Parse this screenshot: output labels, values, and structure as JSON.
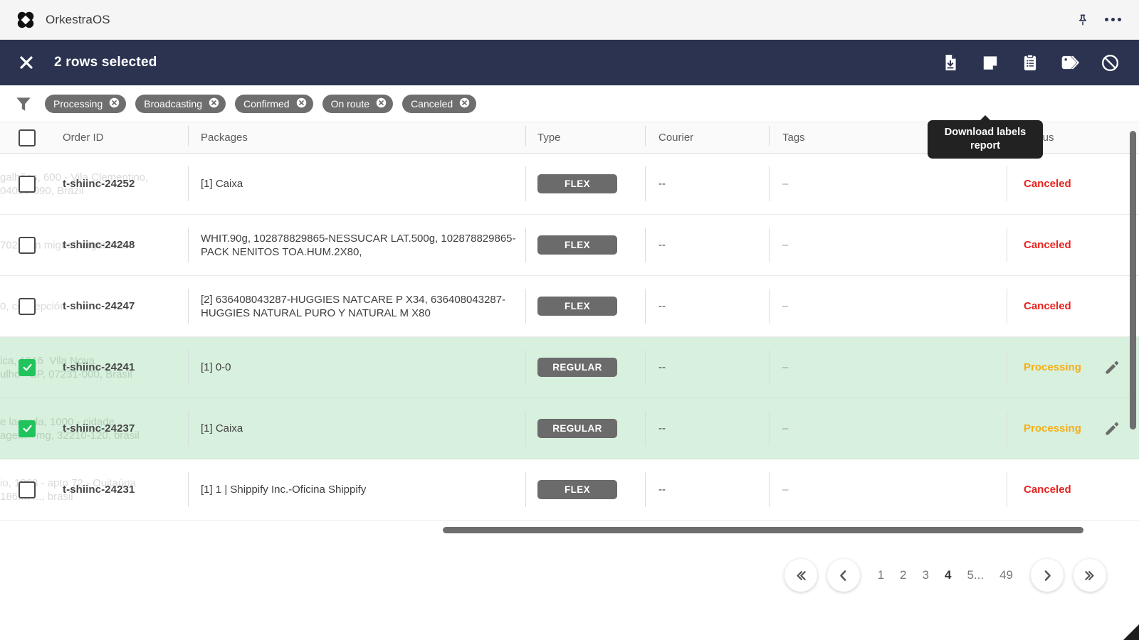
{
  "header": {
    "app_title": "OrkestraOS",
    "logo_icon": "orkestra-logo-icon",
    "pin_icon": "pushpin-icon",
    "more_icon": "more-options-icon"
  },
  "action_bar": {
    "close_icon": "close-icon",
    "selection_label": "2 rows selected",
    "actions": [
      {
        "name": "download-report-button",
        "icon": "file-download-icon"
      },
      {
        "name": "download-labels-report-button",
        "icon": "note-label-icon"
      },
      {
        "name": "clipboard-button",
        "icon": "clipboard-list-icon"
      },
      {
        "name": "tags-button",
        "icon": "tag-icon"
      },
      {
        "name": "cancel-orders-button",
        "icon": "no-entry-icon"
      }
    ],
    "tooltip": "Download labels report"
  },
  "filters": {
    "filter_icon": "filter-funnel-icon",
    "chips": [
      {
        "label": "Processing"
      },
      {
        "label": "Broadcasting"
      },
      {
        "label": "Confirmed"
      },
      {
        "label": "On route"
      },
      {
        "label": "Canceled"
      }
    ]
  },
  "table": {
    "columns": [
      {
        "key": "order_id",
        "label": "Order ID"
      },
      {
        "key": "packages",
        "label": "Packages"
      },
      {
        "key": "type",
        "label": "Type"
      },
      {
        "key": "courier",
        "label": "Courier"
      },
      {
        "key": "tags",
        "label": "Tags"
      },
      {
        "key": "status",
        "label": "Status"
      }
    ],
    "rows": [
      {
        "selected": false,
        "order_id": "t-shiinc-24252",
        "packages": "[1] Caixa",
        "type": "FLEX",
        "courier": "--",
        "tags": "–",
        "status": "Canceled",
        "status_state": "canceled",
        "has_edit": false,
        "ghost": "galhães, 600 - Vila Clementino,\n04026-090, Brazil"
      },
      {
        "selected": false,
        "order_id": "t-shiinc-24248",
        "packages": "WHIT.90g, 102878829865-NESSUCAR LAT.500g, 102878829865-PACK NENITOS TOA.HUM.2X80,",
        "type": "FLEX",
        "courier": "--",
        "tags": "–",
        "status": "Canceled",
        "status_state": "canceled",
        "has_edit": false,
        "ghost": "702, san miguel, argentina"
      },
      {
        "selected": false,
        "order_id": "t-shiinc-24247",
        "packages": "[2] 636408043287-HUGGIES NATCARE P X34, 636408043287-HUGGIES NATURAL PURO Y NATURAL M X80",
        "type": "FLEX",
        "courier": "--",
        "tags": "–",
        "status": "Canceled",
        "status_state": "canceled",
        "has_edit": false,
        "ghost": "0, concepción"
      },
      {
        "selected": true,
        "order_id": "t-shiinc-24241",
        "packages": "[1] 0-0",
        "type": "REGULAR",
        "courier": "--",
        "tags": "–",
        "status": "Processing",
        "status_state": "processing",
        "has_edit": true,
        "ghost": "ica, 1916  Vila Nova\nulho - SP, 07231-000, Brasil"
      },
      {
        "selected": true,
        "order_id": "t-shiinc-24237",
        "packages": "[1] Caixa",
        "type": "REGULAR",
        "courier": "--",
        "tags": "–",
        "status": "Processing",
        "status_state": "processing",
        "has_edit": true,
        "ghost": "e lacerda, 1000 - cidade\nagem - mg, 32210-120, brasil"
      },
      {
        "selected": false,
        "order_id": "t-shiinc-24231",
        "packages": "[1] 1 | Shippify Inc.-Oficina Shippify",
        "type": "FLEX",
        "courier": "--",
        "tags": "–",
        "status": "Canceled",
        "status_state": "canceled",
        "has_edit": false,
        "ghost": "io, 1868 - apto 72 - Quitaúna\n186..., ..., brasil"
      }
    ]
  },
  "pagination": {
    "first_label": "«",
    "prev_label": "‹",
    "next_label": "›",
    "last_label": "»",
    "pages": [
      "1",
      "2",
      "3",
      "4",
      "5...",
      "49"
    ],
    "active_page": "4"
  },
  "colors": {
    "navy": "#2b3350",
    "selected_row": "#d8f0de",
    "checkbox_green": "#21c45c",
    "status_canceled": "#e8231f",
    "status_processing": "#f5ae17",
    "badge_gray": "#6b6b6b",
    "chip_gray": "#6e6e6e"
  }
}
